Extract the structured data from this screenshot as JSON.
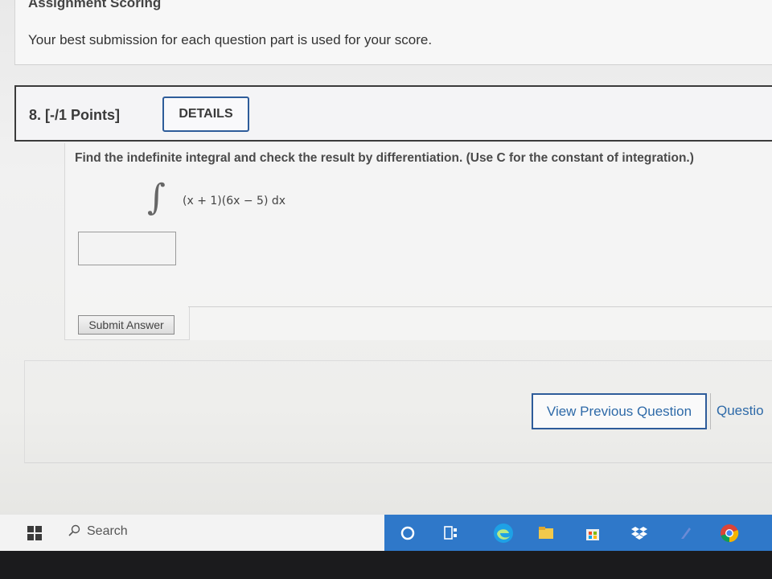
{
  "assignment": {
    "title": "Assignment Scoring",
    "description": "Your best submission for each question part is used for your score."
  },
  "question": {
    "number_label": "8. [-/1 Points]",
    "details_label": "DETAILS",
    "instruction": "Find the indefinite integral and check the result by differentiation. (Use C for the constant of integration.)",
    "integral_symbol": "∫",
    "integrand": "(x + 1)(6x − 5) dx",
    "answer_value": "",
    "submit_label": "Submit Answer"
  },
  "navigation": {
    "prev_label": "View Previous Question",
    "next_label": "Questio"
  },
  "taskbar": {
    "search_label": "Search",
    "accent_color": "#2f78c9",
    "icons": [
      "windows-logo-icon",
      "search-icon",
      "cortana-icon",
      "task-view-icon",
      "edge-icon",
      "file-explorer-icon",
      "store-icon",
      "dropbox-icon",
      "app-icon",
      "chrome-icon"
    ]
  }
}
